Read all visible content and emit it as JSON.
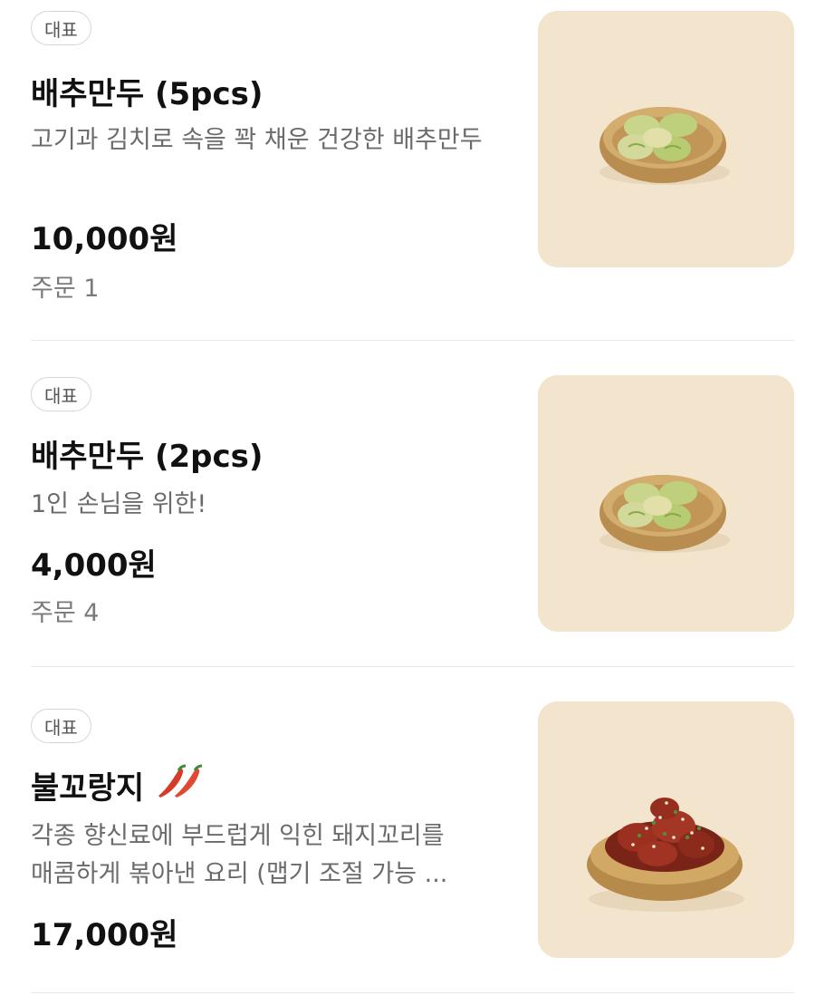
{
  "menu": {
    "items": [
      {
        "badge": "대표",
        "name": "배추만두 (5pcs)",
        "description": "고기과 김치로 속을 꽉 채운 건강한 배추만두",
        "price": "10,000원",
        "orders": "주문 1",
        "photo": "cabbage-dumplings-in-brass-bowl"
      },
      {
        "badge": "대표",
        "name": "배추만두 (2pcs)",
        "description": "1인 손님을 위한!",
        "price": "4,000원",
        "orders": "주문 4",
        "photo": "cabbage-dumplings-in-brass-bowl"
      },
      {
        "badge": "대표",
        "name": "불꼬랑지",
        "spicy_icon": "chili-peppers-icon",
        "description_line1": "각종 향신료에 부드럽게 익힌 돼지꼬리를",
        "description_line2": "매콤하게 볶아낸 요리 (맵기 조절 가능 ...",
        "price": "17,000원",
        "photo": "spicy-braised-pork-tail-in-brass-bowl"
      }
    ]
  },
  "colors": {
    "photo_background": "#f3e4cd",
    "brass_bowl": "#c9a468",
    "chili": "#d83a2a"
  }
}
